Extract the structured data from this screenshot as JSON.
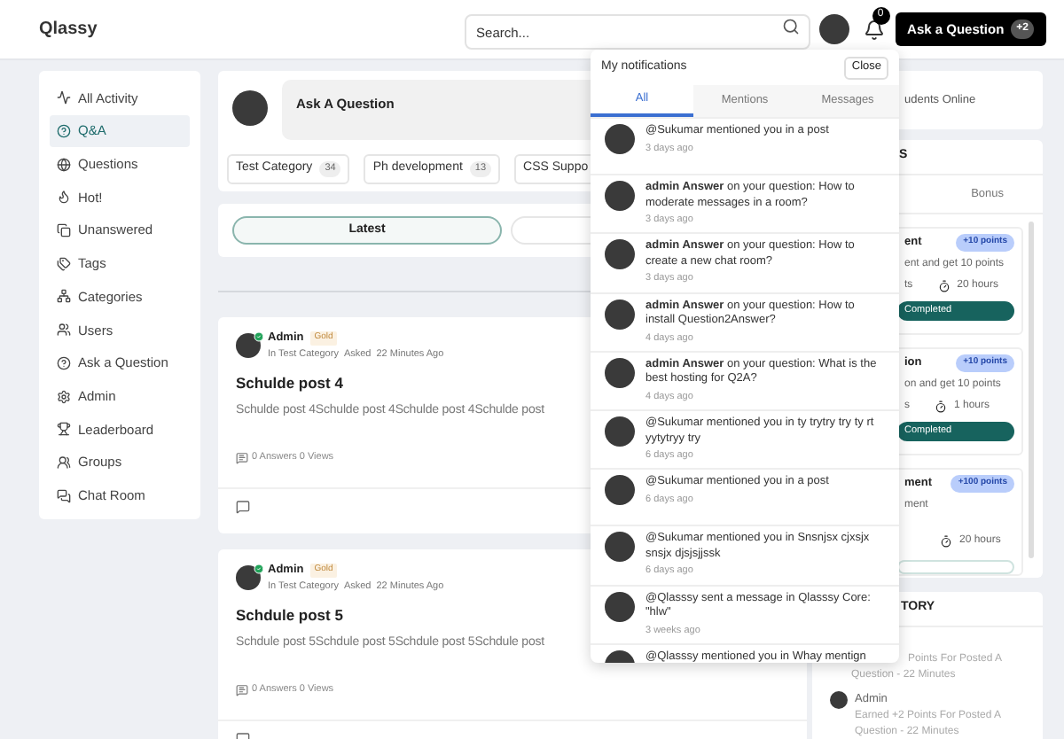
{
  "header": {
    "logo": "Qlassy",
    "search": {
      "placeholder": "Search..."
    },
    "notification_count": "0",
    "ask_button": {
      "label": "Ask a Question",
      "badge": "+2"
    }
  },
  "sidebar": {
    "items": [
      {
        "label": "All Activity",
        "selected": false
      },
      {
        "label": "Q&A",
        "selected": true
      },
      {
        "label": "Questions",
        "selected": false
      },
      {
        "label": "Hot!",
        "selected": false
      },
      {
        "label": "Unanswered",
        "selected": false
      },
      {
        "label": "Tags",
        "selected": false
      },
      {
        "label": "Categories",
        "selected": false
      },
      {
        "label": "Users",
        "selected": false
      },
      {
        "label": "Ask a Question",
        "selected": false
      },
      {
        "label": "Admin",
        "selected": false
      },
      {
        "label": "Leaderboard",
        "selected": false
      },
      {
        "label": "Groups",
        "selected": false
      },
      {
        "label": "Chat Room",
        "selected": false
      }
    ]
  },
  "ask_box": {
    "label": "Ask A Question"
  },
  "categories": [
    {
      "name": "Test Category",
      "count": "34"
    },
    {
      "name": "Ph development",
      "count": "13"
    },
    {
      "name": "CSS Suppo"
    }
  ],
  "feed_tabs": [
    {
      "label": "Latest",
      "selected": true
    },
    {
      "selected": false
    }
  ],
  "posts": [
    {
      "author": "Admin",
      "verified": true,
      "badge": "Gold",
      "category": "In Test Category",
      "asked": "Asked",
      "time": "22 Minutes Ago",
      "title": "Schulde post 4",
      "body": "Schulde post 4Schulde post 4Schulde post 4Schulde post",
      "stats": "0 Answers 0 Views"
    },
    {
      "author": "Admin",
      "verified": true,
      "badge": "Gold",
      "category": "In Test Category",
      "asked": "Asked",
      "time": "22 Minutes Ago",
      "title": "Schdule post 5",
      "body": "Schdule post 5Schdule post 5Schdule post 5Schdule post",
      "stats": "0 Answers 0 Views"
    }
  ],
  "right_panel": {
    "online": "udents Online",
    "tasks_title": "S",
    "tasks_tabs": [
      {
        "label": "Bonus",
        "selected": false
      }
    ],
    "tasks": [
      {
        "title": "ent",
        "points": "+10 points",
        "desc": "ent and get 10 points",
        "meta": "ts",
        "time": "20 hours",
        "completed": true,
        "status": "Completed"
      },
      {
        "title": "ion",
        "points": "+10 points",
        "desc": "on and get 10 points",
        "meta": "s",
        "time": "1 hours",
        "completed": true,
        "status": "Completed"
      },
      {
        "title": "ment",
        "points": "+100 points",
        "desc": "ment",
        "time": "20 hours",
        "completed": false
      }
    ],
    "history_title": "TORY",
    "history": [
      {
        "lines": [
          "Points For Posted A",
          "Question - 22 Minutes"
        ]
      },
      {
        "author": "Admin",
        "lines": [
          "Earned +2 Points For Posted A",
          "Question - 22 Minutes"
        ]
      }
    ]
  },
  "notifications": {
    "title": "My notifications",
    "close": "Close",
    "tabs": [
      {
        "label": "All",
        "selected": true
      },
      {
        "label": "Mentions",
        "selected": false
      },
      {
        "label": "Messages",
        "selected": false
      }
    ],
    "items": [
      {
        "text": "@Sukumar mentioned you in a post",
        "time": "3 days ago"
      },
      {
        "text": "**admin Answer** on your question: How to moderate messages in a room?",
        "time": "3 days ago"
      },
      {
        "text": "**admin Answer** on your question: How to create a new chat room?",
        "time": "3 days ago"
      },
      {
        "text": "**admin Answer** on your question: How to install Question2Answer?",
        "time": "4 days ago"
      },
      {
        "text": "**admin Answer** on your question: What is the best hosting for Q2A?",
        "time": "4 days ago"
      },
      {
        "text": "@Sukumar mentioned you in ty trytry try ty rt yytytryy try",
        "time": "6 days ago"
      },
      {
        "text": "@Sukumar mentioned you in a post",
        "time": "6 days ago"
      },
      {
        "text": "@Sukumar mentioned you in Snsnjsx cjxsjx snsjx djsjsjjssk",
        "time": "6 days ago"
      },
      {
        "text": "@Qlasssy sent a message in Qlasssy Core: \"hlw\"",
        "time": "3 weeks ago"
      },
      {
        "text": "@Qlasssy mentioned you in Whay mentign"
      }
    ]
  }
}
